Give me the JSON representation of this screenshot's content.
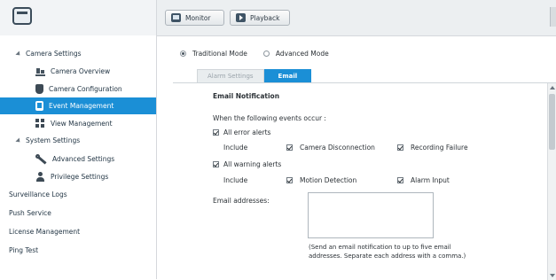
{
  "toolbar": {
    "monitor_label": "Monitor",
    "playback_label": "Playback"
  },
  "sidebar": {
    "camera_settings": "Camera Settings",
    "camera_overview": "Camera Overview",
    "camera_configuration": "Camera Configuration",
    "event_management": "Event Management",
    "view_management": "View Management",
    "system_settings": "System Settings",
    "advanced_settings": "Advanced Settings",
    "privilege_settings": "Privilege Settings",
    "surveillance_logs": "Surveillance Logs",
    "push_service": "Push Service",
    "license_management": "License Management",
    "ping_test": "Ping Test",
    "selected_item": "Event Management"
  },
  "mode": {
    "traditional": "Traditional Mode",
    "advanced": "Advanced Mode",
    "selected": "Traditional Mode"
  },
  "tabs": {
    "alarm_settings": "Alarm Settings",
    "email": "Email",
    "active": "Email"
  },
  "email_panel": {
    "title": "Email Notification",
    "events_prompt": "When the following events occur :",
    "all_error_alerts": "All error alerts",
    "include_1": "Include",
    "camera_disconnection": "Camera Disconnection",
    "recording_failure": "Recording Failure",
    "all_warning_alerts": "All warning alerts",
    "include_2": "Include",
    "motion_detection": "Motion Detection",
    "alarm_input": "Alarm Input",
    "email_addresses_label": "Email addresses:",
    "email_addresses_value": "",
    "note_line1": "(Send an email notification to up to five email",
    "note_line2": "addresses. Separate each address with a comma.)",
    "checked": {
      "all_error_alerts": true,
      "camera_disconnection": true,
      "recording_failure": true,
      "all_warning_alerts": true,
      "motion_detection": true,
      "alarm_input": true
    }
  },
  "colors": {
    "accent": "#1b8fd6",
    "sidebar_bg": "#ffffff",
    "topbar_bg": "#eceff1"
  }
}
